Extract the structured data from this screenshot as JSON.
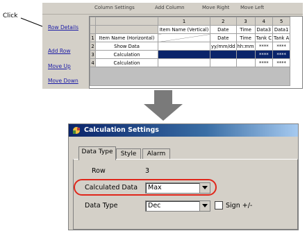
{
  "callout": {
    "label": "Click"
  },
  "editor": {
    "toolbar": [
      "Column Settings",
      "Add Column",
      "Move Right",
      "Move Left"
    ],
    "side_links": [
      "Row Details",
      "Add Row",
      "Move Up",
      "Move Down"
    ],
    "grid": {
      "col_numbers": [
        "",
        "1",
        "2",
        "3",
        "4",
        "5"
      ],
      "col_headers": [
        "",
        "Item Name (Vertical)",
        "Date",
        "Time",
        "Data3",
        "Data1"
      ],
      "rows": [
        {
          "num": "1",
          "name": "Item Name (Horizontal)",
          "cells": [
            "",
            "Date",
            "Time",
            "Tank C",
            "Tank A"
          ]
        },
        {
          "num": "2",
          "name": "Show Data",
          "cells": [
            "",
            "yy/mm/dd",
            "hh:mm",
            "****",
            "****"
          ]
        },
        {
          "num": "3",
          "name": "Calculation",
          "cells": [
            "",
            "",
            "",
            "****",
            "****"
          ]
        },
        {
          "num": "4",
          "name": "Calculation",
          "cells": [
            "",
            "",
            "",
            "****",
            "****"
          ]
        }
      ],
      "selected_row": 2
    }
  },
  "dialog": {
    "title": "Calculation Settings",
    "tabs": [
      "Data Type",
      "Style",
      "Alarm"
    ],
    "active_tab": 0,
    "fields": {
      "row_label": "Row",
      "row_value": "3",
      "calc_label": "Calculated Data",
      "calc_value": "Max",
      "type_label": "Data Type",
      "type_value": "Dec",
      "sign_label": "Sign +/-"
    }
  },
  "colors": {
    "highlight": "#e0261a",
    "selection": "#0a246a",
    "arrow": "#7a7a7a"
  }
}
